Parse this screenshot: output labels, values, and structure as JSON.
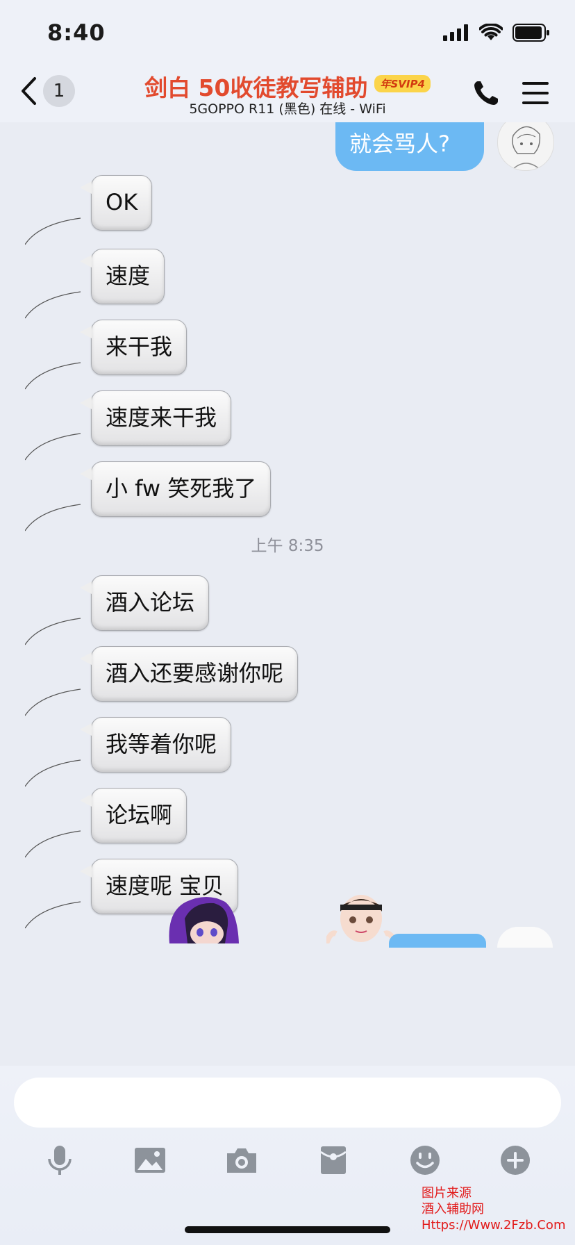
{
  "status_bar": {
    "time": "8:40"
  },
  "nav": {
    "unread_count": "1",
    "title": "剑白  50收徒教写辅助",
    "vip_badge": "年SVIP4",
    "subtitle": "5GOPPO R11 (黑色) 在线 - WiFi"
  },
  "messages_out": [
    {
      "text": "就会骂人?"
    }
  ],
  "messages_in": [
    {
      "text": "OK"
    },
    {
      "text": "速度"
    },
    {
      "text": "来干我"
    },
    {
      "text": "速度来干我"
    },
    {
      "text": "小 fw 笑死我了"
    },
    {
      "text": "酒入论坛"
    },
    {
      "text": "酒入还要感谢你呢"
    },
    {
      "text": "我等着你呢"
    },
    {
      "text": "论坛啊"
    },
    {
      "text": "速度呢 宝贝"
    }
  ],
  "timestamp": "上午 8:35",
  "input": {
    "value": "",
    "placeholder": ""
  },
  "toolbar": [
    "microphone-icon",
    "image-icon",
    "camera-icon",
    "red-packet-icon",
    "emoji-icon",
    "plus-icon"
  ],
  "watermark": {
    "line1": "图片来源",
    "line2": "酒入辅助网",
    "line3": "Https://Www.2Fzb.Com"
  },
  "colors": {
    "bubble_out": "#6cb9f3",
    "title": "#e24a2e",
    "watermark": "#e21b1b"
  }
}
